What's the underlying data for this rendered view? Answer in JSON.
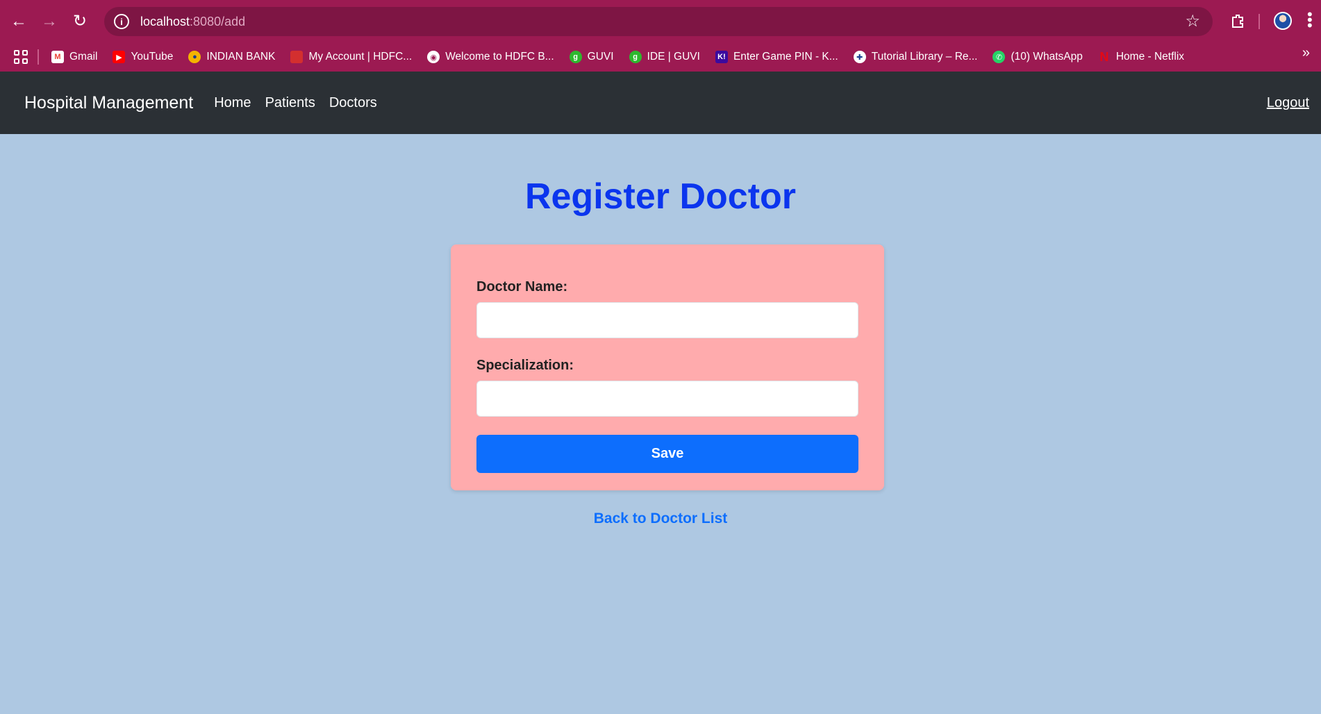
{
  "browser": {
    "url_host": "localhost",
    "url_path": ":8080/add",
    "bookmarks": [
      {
        "label": "Gmail",
        "icon": "gmail-icon",
        "color": "#ea4335"
      },
      {
        "label": "YouTube",
        "icon": "youtube-icon",
        "color": "#ff0000"
      },
      {
        "label": "INDIAN BANK",
        "icon": "indian-bank-icon",
        "color": "#f4b400"
      },
      {
        "label": "My Account | HDFC...",
        "icon": "hdfc-icon",
        "color": "#d32f2f"
      },
      {
        "label": "Welcome to HDFC B...",
        "icon": "globe-icon",
        "color": "#ffffff"
      },
      {
        "label": "GUVI",
        "icon": "guvi-icon",
        "color": "#2eb82e"
      },
      {
        "label": "IDE | GUVI",
        "icon": "guvi-icon",
        "color": "#2eb82e"
      },
      {
        "label": "Enter Game PIN - K...",
        "icon": "kahoot-icon",
        "color": "#3b0a9e"
      },
      {
        "label": "Tutorial Library – Re...",
        "icon": "library-icon",
        "color": "#ffffff"
      },
      {
        "label": "(10) WhatsApp",
        "icon": "whatsapp-icon",
        "color": "#25d366"
      },
      {
        "label": "Home - Netflix",
        "icon": "netflix-icon",
        "color": "#e50914"
      }
    ]
  },
  "navbar": {
    "brand": "Hospital Management",
    "links": [
      "Home",
      "Patients",
      "Doctors"
    ],
    "logout": "Logout"
  },
  "main": {
    "title": "Register Doctor",
    "form": {
      "doctor_name_label": "Doctor Name:",
      "doctor_name_value": "",
      "specialization_label": "Specialization:",
      "specialization_value": "",
      "save_label": "Save"
    },
    "back_link": "Back to Doctor List"
  },
  "colors": {
    "page_bg": "#aec8e2",
    "navbar_bg": "#2b3035",
    "card_bg": "#ffabad",
    "title": "#0b35ee",
    "primary": "#0d6efd",
    "browser_frame": "#9c1a52"
  }
}
